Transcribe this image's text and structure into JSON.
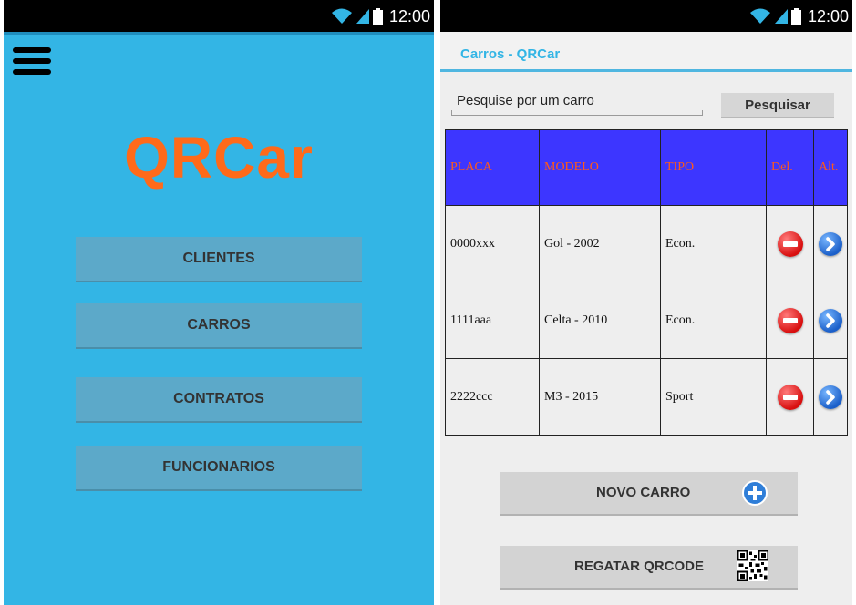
{
  "status_bar": {
    "time": "12:00"
  },
  "left_screen": {
    "brand": "QRCar",
    "menu": [
      {
        "label": "CLIENTES"
      },
      {
        "label": "CARROS"
      },
      {
        "label": "CONTRATOS"
      },
      {
        "label": "FUNCIONARIOS"
      }
    ]
  },
  "right_screen": {
    "title": "Carros - QRCar",
    "search": {
      "placeholder": "Pesquise por um carro",
      "button_label": "Pesquisar"
    },
    "table": {
      "headers": [
        "PLACA",
        "MODELO",
        "TIPO",
        "Del.",
        "Alt."
      ],
      "rows": [
        [
          "0000xxx",
          "Gol - 2002",
          "Econ."
        ],
        [
          "1111aaa",
          "Celta - 2010",
          "Econ."
        ],
        [
          "2222ccc",
          "M3 - 2015",
          "Sport"
        ]
      ]
    },
    "buttons": {
      "new_car": "NOVO CARRO",
      "scan_qr": "REGATAR QRCODE"
    }
  },
  "colors": {
    "primary_blue": "#33b5e5",
    "brand_orange": "#ff6a1a",
    "header_blue": "#3d36ff",
    "header_text": "#ff5a1a"
  },
  "icons": [
    "wifi-icon",
    "signal-icon",
    "battery-icon",
    "menu-icon",
    "delete-icon",
    "edit-arrow-icon",
    "add-icon",
    "qr-code-icon"
  ]
}
